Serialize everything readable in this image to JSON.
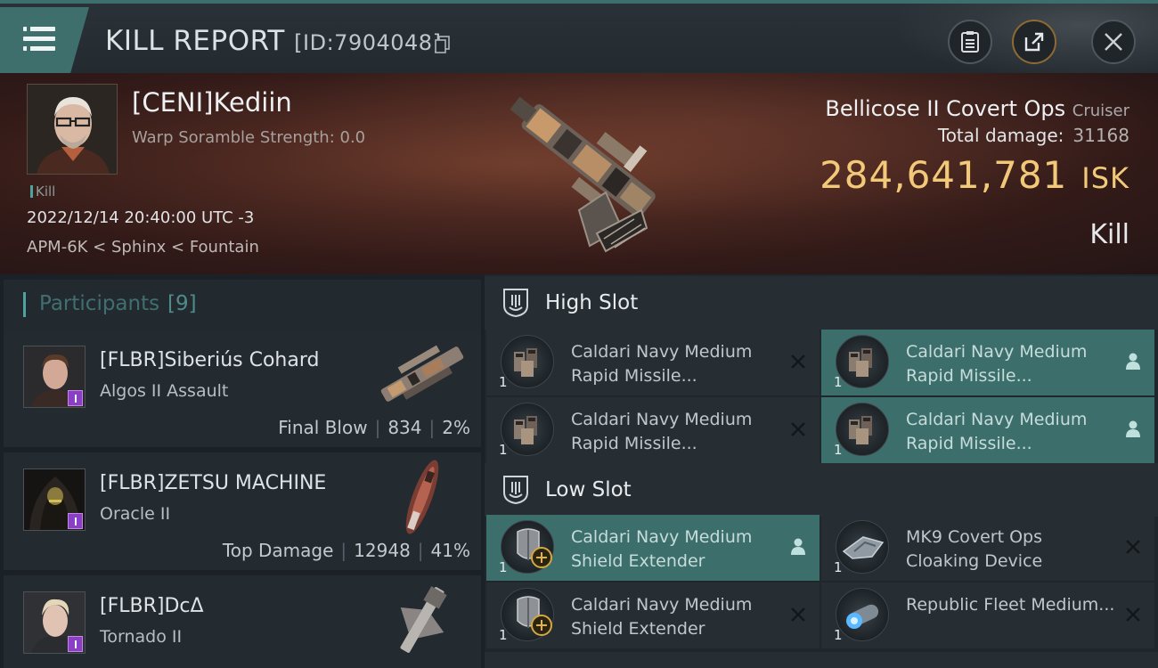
{
  "header": {
    "title": "KILL REPORT",
    "report_id": "[ID:7904048]"
  },
  "victim": {
    "name": "[CENI]Kediin",
    "scramble": "Warp Soramble Strength: 0.0",
    "tag": "Kill",
    "datetime": "2022/12/14 20:40:00 UTC -3",
    "location": "APM-6K < Sphinx < Fountain",
    "ship": "Bellicose II Covert Ops",
    "ship_class": "Cruiser",
    "damage_label": "Total damage:",
    "damage_value": "31168",
    "isk_value": "284,641,781",
    "isk_unit": "ISK",
    "result": "Kill"
  },
  "participants": {
    "title": "Participants",
    "count": "[9]",
    "rows": [
      {
        "name": "[FLBR]Siberiús Cohard",
        "ship": "Algos II Assault",
        "label": "Final Blow",
        "damage": "834",
        "percent": "2%"
      },
      {
        "name": "[FLBR]ZETSU MACHINE",
        "ship": "Oracle II",
        "label": "Top Damage",
        "damage": "12948",
        "percent": "41%"
      },
      {
        "name": "[FLBR]DcΔ",
        "ship": "Tornado II",
        "label": "",
        "damage": "",
        "percent": ""
      }
    ]
  },
  "slots": {
    "high": {
      "title": "High Slot",
      "modules": [
        {
          "name": "Caldari Navy Medium Rapid Missile...",
          "qty": "1",
          "state": "destroyed"
        },
        {
          "name": "Caldari Navy Medium Rapid Missile...",
          "qty": "1",
          "state": "dropped"
        },
        {
          "name": "Caldari Navy Medium Rapid Missile...",
          "qty": "1",
          "state": "destroyed"
        },
        {
          "name": "Caldari Navy Medium Rapid Missile...",
          "qty": "1",
          "state": "dropped"
        }
      ]
    },
    "low": {
      "title": "Low Slot",
      "modules": [
        {
          "name": "Caldari Navy Medium Shield Extender",
          "qty": "1",
          "state": "dropped"
        },
        {
          "name": "MK9 Covert Ops Cloaking Device",
          "qty": "1",
          "state": "destroyed"
        },
        {
          "name": "Caldari Navy Medium Shield Extender",
          "qty": "1",
          "state": "destroyed"
        },
        {
          "name": "Republic Fleet Medium...",
          "qty": "1",
          "state": "destroyed"
        }
      ]
    }
  },
  "colors": {
    "accent": "#3f6f6d",
    "isk": "#f2c978",
    "highlight": "#3c6e6b"
  }
}
